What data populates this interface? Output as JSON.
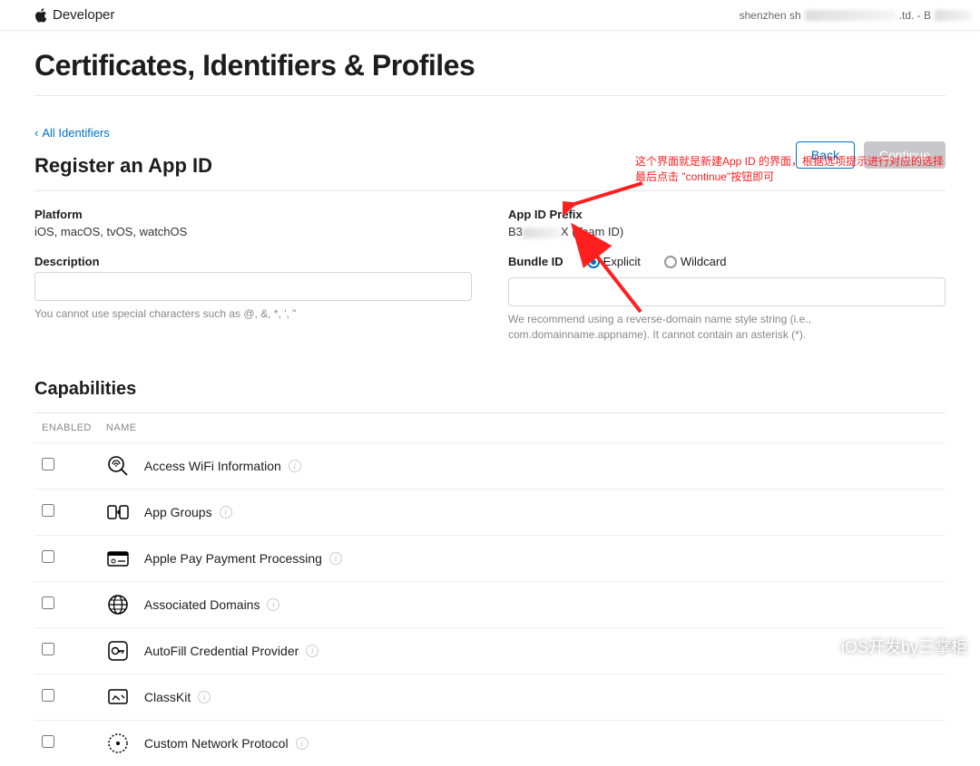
{
  "topbar": {
    "brand": "Developer",
    "team_prefix": "shenzhen sh",
    "team_mid_hidden": true,
    "team_suffix": ".td. - B",
    "team_tail_hidden": true
  },
  "page": {
    "title": "Certificates, Identifiers & Profiles",
    "back_link": "All Identifiers",
    "section_title": "Register an App ID",
    "back_btn": "Back",
    "continue_btn": "Continue"
  },
  "annotation": {
    "line1": "这个界面就是新建App ID 的界面，根据选项提示进行对应的选择",
    "line2": "最后点击 \"continue\"按钮即可"
  },
  "form": {
    "platform_label": "Platform",
    "platform_value": "iOS, macOS, tvOS, watchOS",
    "prefix_label": "App ID Prefix",
    "prefix_value_prefix": "B3",
    "prefix_value_suffix": "X (Team ID)",
    "description_label": "Description",
    "description_helper": "You cannot use special characters such as @, &, *, ', \"",
    "bundle_label": "Bundle ID",
    "bundle_explicit": "Explicit",
    "bundle_wildcard": "Wildcard",
    "bundle_helper": "We recommend using a reverse-domain name style string (i.e., com.domainname.appname). It cannot contain an asterisk (*)."
  },
  "capabilities": {
    "title": "Capabilities",
    "col_enabled": "ENABLED",
    "col_name": "NAME",
    "items": [
      {
        "name": "Access WiFi Information",
        "icon": "magnify-wifi"
      },
      {
        "name": "App Groups",
        "icon": "app-groups"
      },
      {
        "name": "Apple Pay Payment Processing",
        "icon": "apple-pay"
      },
      {
        "name": "Associated Domains",
        "icon": "globe"
      },
      {
        "name": "AutoFill Credential Provider",
        "icon": "key"
      },
      {
        "name": "ClassKit",
        "icon": "classkit"
      },
      {
        "name": "Custom Network Protocol",
        "icon": "dots-circle"
      }
    ]
  },
  "watermark": {
    "text": "iOS开发by三掌柜"
  }
}
